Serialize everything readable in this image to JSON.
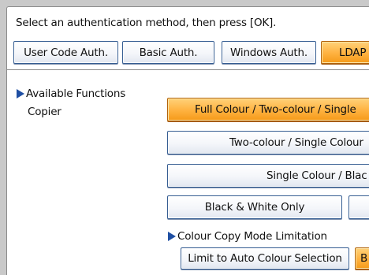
{
  "instruction": "Select an authentication method, then press [OK].",
  "auth_tabs": [
    {
      "label": "User Code Auth."
    },
    {
      "label": "Basic Auth."
    },
    {
      "label": "Windows Auth."
    },
    {
      "label": "LDAP"
    }
  ],
  "section_title": "Available Functions",
  "copier_label": "Copier",
  "copier_options": [
    {
      "label": "Full Colour / Two-colour / Single"
    },
    {
      "label": "Two-colour / Single Colour"
    },
    {
      "label": "Single Colour / Blac"
    },
    {
      "label": "Black & White Only"
    }
  ],
  "limit_title": "Colour Copy Mode Limitation",
  "limit_options": [
    {
      "label": "Limit to Auto Colour Selection"
    },
    {
      "label": "B"
    }
  ],
  "colors": {
    "selected": "#ffb444",
    "accent": "#1f4fa3",
    "button_border": "#355d92"
  }
}
